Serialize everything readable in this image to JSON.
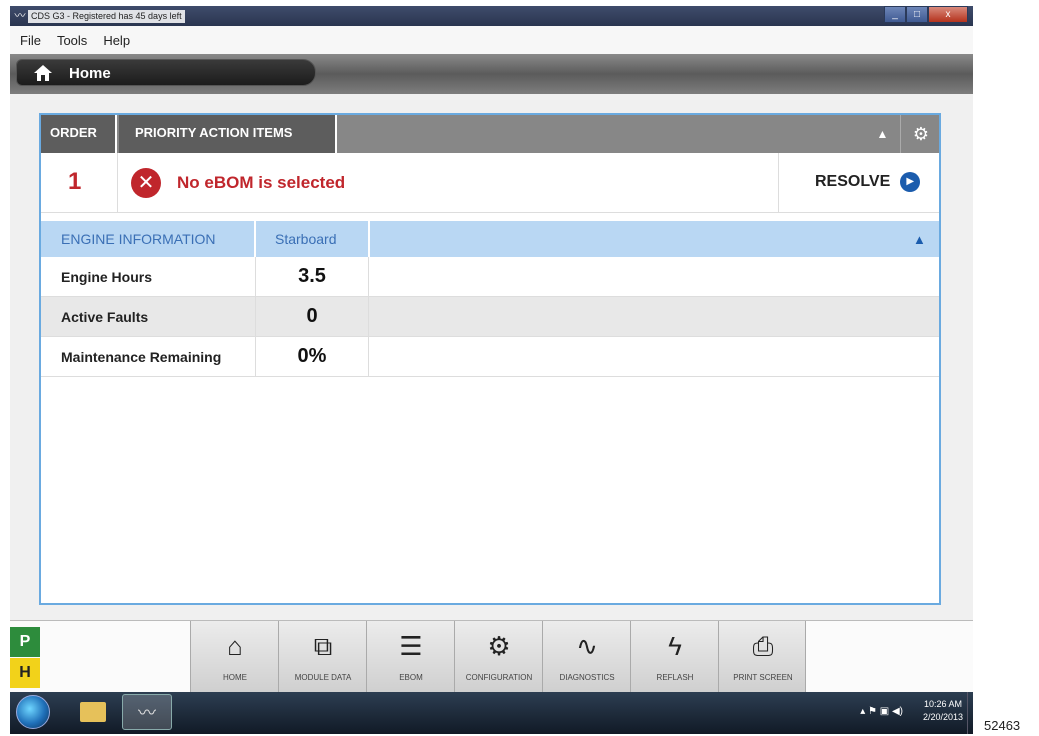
{
  "window": {
    "title": "CDS G3 - Registered has 45 days left",
    "controls": {
      "minimize_icon": "_",
      "maximize_icon": "□",
      "close_icon": "x"
    }
  },
  "menu": [
    "File",
    "Tools",
    "Help"
  ],
  "home_tab": {
    "label": "Home",
    "icon": "house-icon"
  },
  "priority_panel": {
    "order_header": "ORDER",
    "title": "PRIORITY ACTION ITEMS",
    "collapse_icon": "▲",
    "settings_icon": "⚙",
    "items": [
      {
        "order": "1",
        "icon": "✕",
        "message": "No eBOM is selected",
        "action": "RESOLVE",
        "action_icon": "▶"
      }
    ]
  },
  "engine_info": {
    "header": "ENGINE INFORMATION",
    "column": "Starboard",
    "collapse_icon": "▲",
    "rows": [
      {
        "label": "Engine Hours",
        "value": "3.5"
      },
      {
        "label": "Active Faults",
        "value": "0"
      },
      {
        "label": "Maintenance Remaining",
        "value": "0%"
      }
    ]
  },
  "side_badges": [
    "P",
    "H"
  ],
  "toolbar": [
    {
      "label": "HOME",
      "icon": "⌂"
    },
    {
      "label": "MODULE DATA",
      "icon": "⧉"
    },
    {
      "label": "EBOM",
      "icon": "☰"
    },
    {
      "label": "CONFIGURATION",
      "icon": "⚙"
    },
    {
      "label": "DIAGNOSTICS",
      "icon": "∿"
    },
    {
      "label": "REFLASH",
      "icon": "ϟ"
    },
    {
      "label": "PRINT SCREEN",
      "icon": "⎙"
    }
  ],
  "taskbar": {
    "tray_icons": "▴  ⚑  ▣  ◀)",
    "time": "10:26 AM",
    "date": "2/20/2013"
  },
  "figure_id": "52463",
  "colors": {
    "accent_red": "#c0262c",
    "accent_blue": "#1b5cad",
    "panel_border": "#6aaae0",
    "engine_header_bg": "#b9d7f3",
    "badge_p": "#2d8c3c",
    "badge_h": "#f2d21a"
  }
}
